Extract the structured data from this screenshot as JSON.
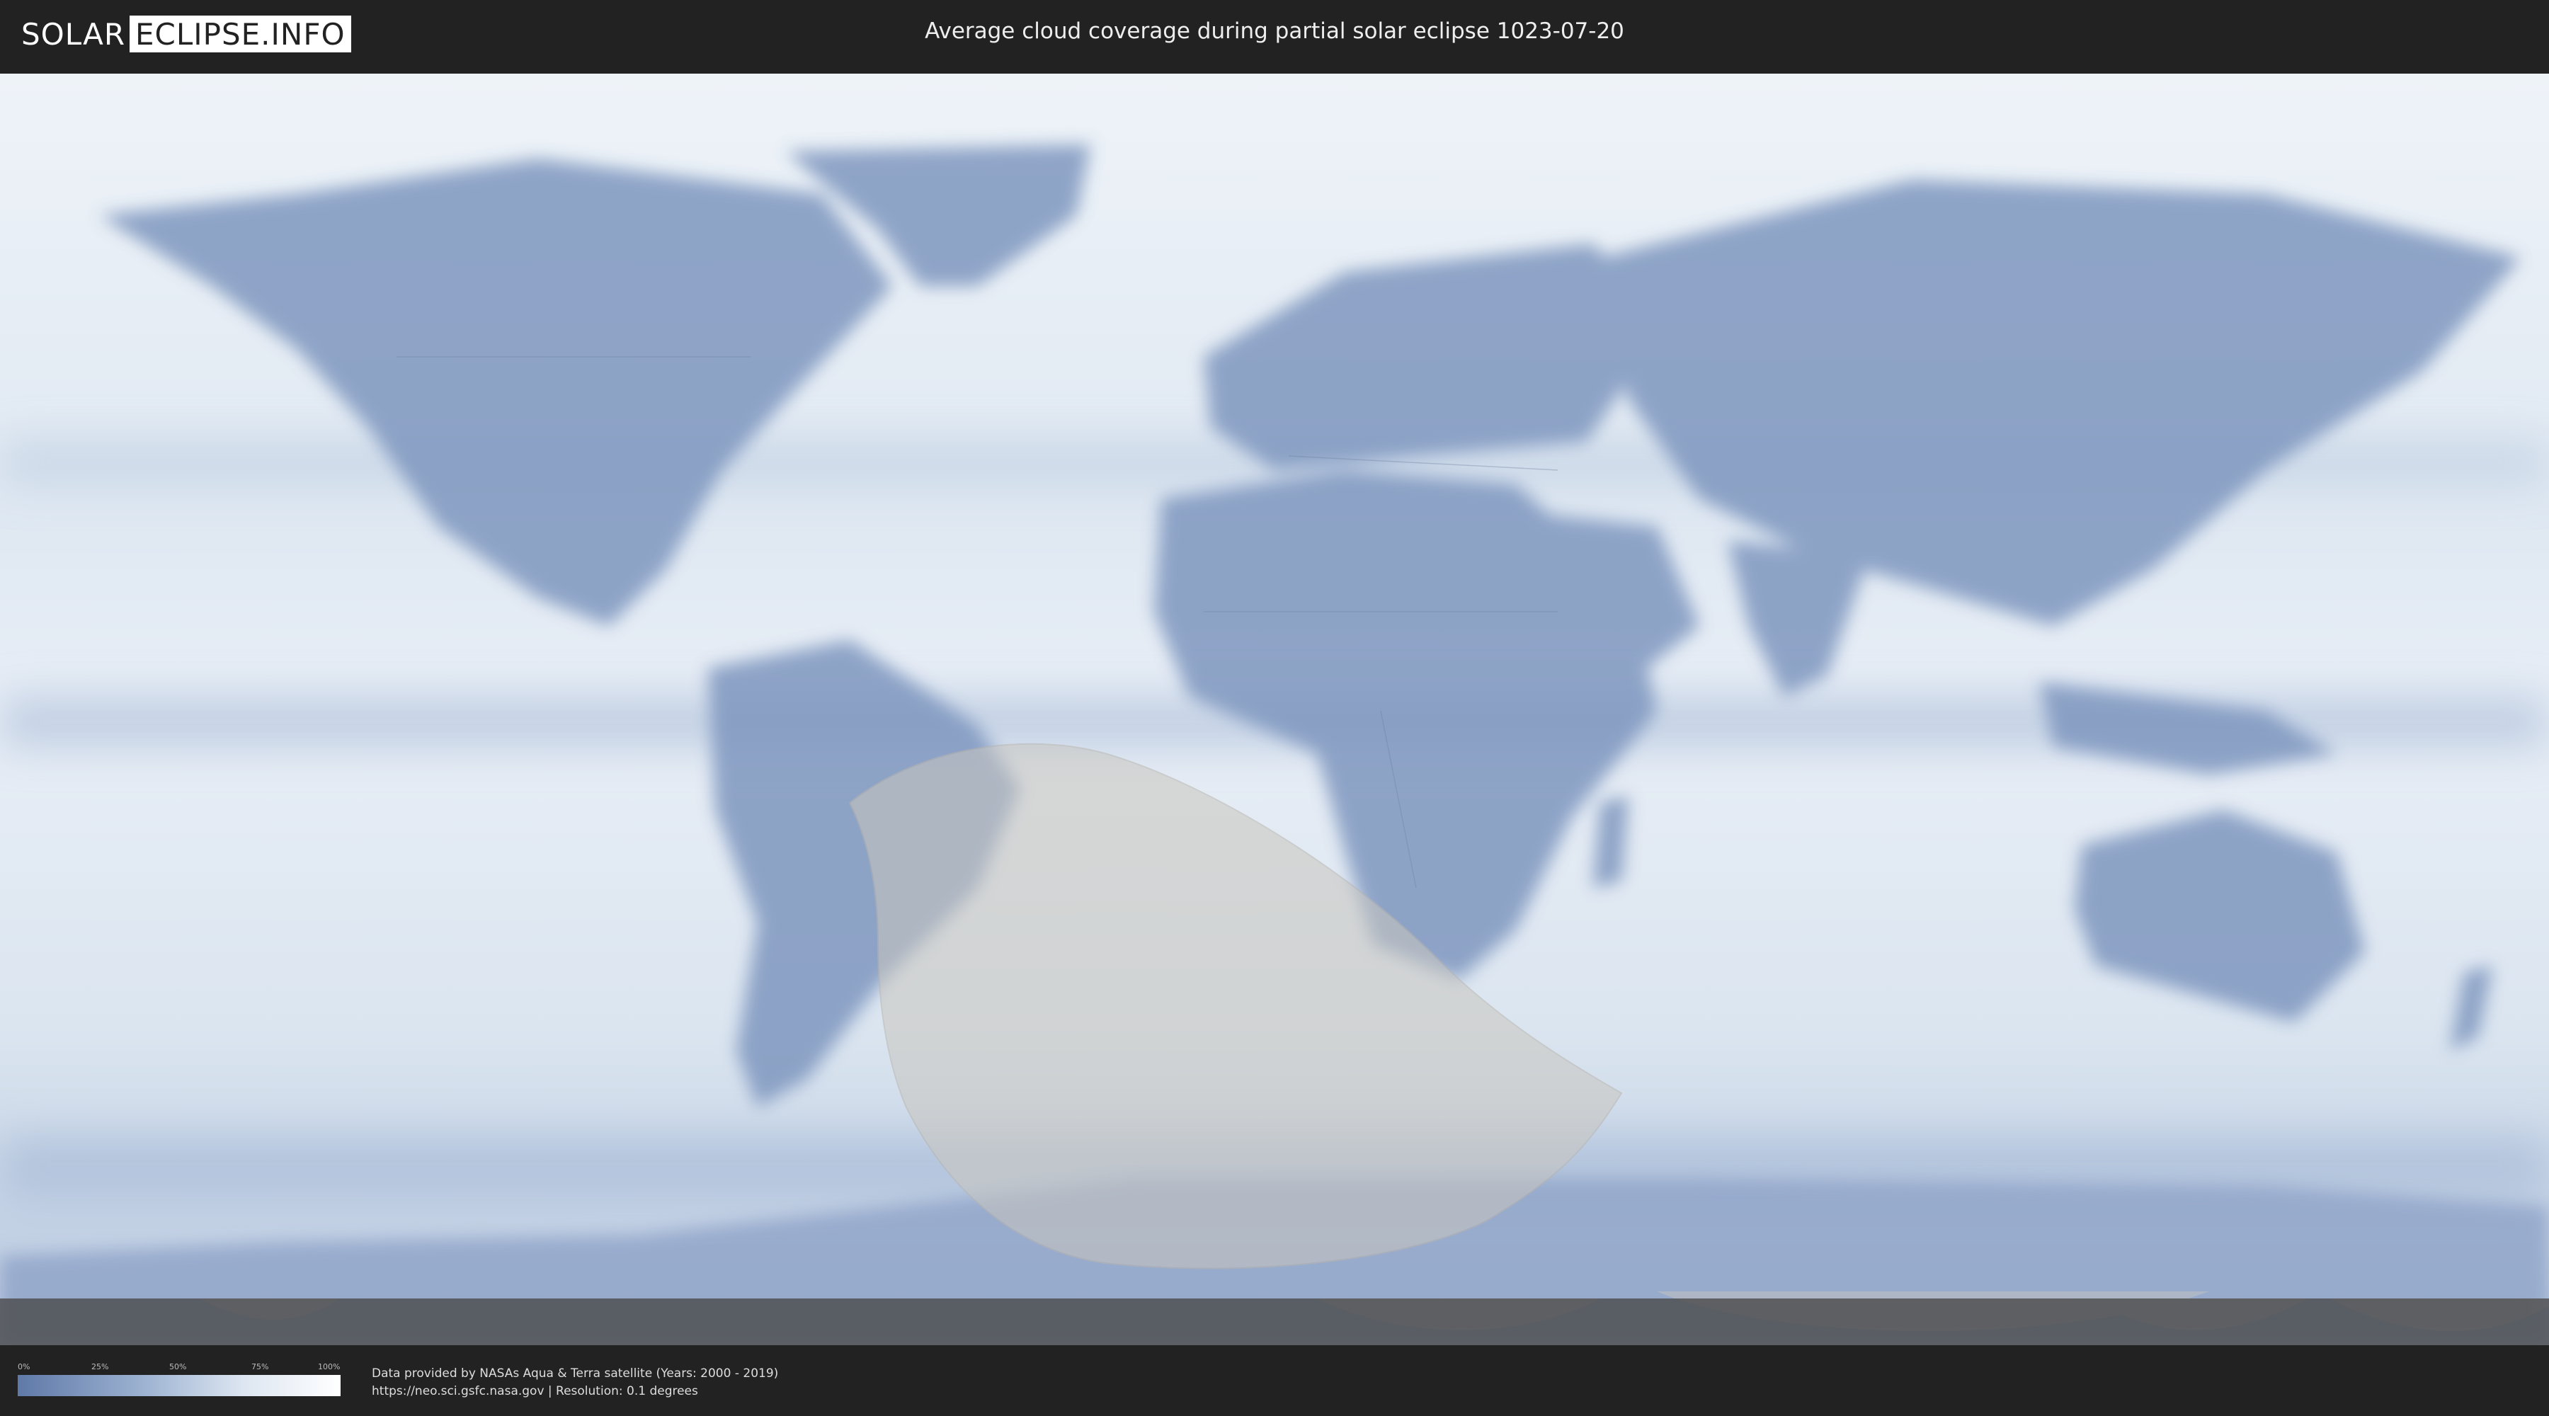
{
  "header": {
    "logo_left": "SOLAR",
    "logo_right": "ECLIPSE.INFO",
    "title": "Average cloud coverage during partial solar eclipse 1023-07-20"
  },
  "legend": {
    "ticks": [
      "0%",
      "25%",
      "50%",
      "75%",
      "100%"
    ],
    "colors": {
      "low": "#5f79a8",
      "mid": "#9fb4d3",
      "high": "#ffffff"
    }
  },
  "credits": {
    "line1": "Data provided by NASAs Aqua & Terra satellite (Years: 2000 - 2019)",
    "line2": "https://neo.sci.gsfc.nasa.gov | Resolution: 0.1 degrees"
  },
  "map": {
    "ocean_color": "#e9eff6",
    "land_cloud_color": "#7f97bf",
    "eclipse_zone_color": "#c9c6bf"
  }
}
